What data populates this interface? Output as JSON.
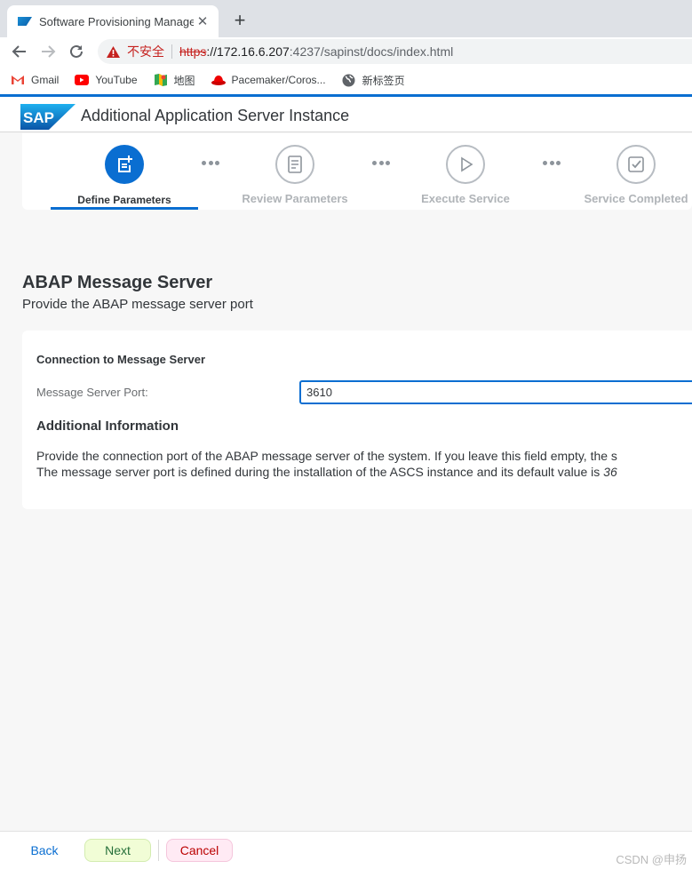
{
  "browser": {
    "tab": {
      "title": "Software Provisioning Manage",
      "close_glyph": "✕"
    },
    "new_tab_glyph": "+",
    "address_bar": {
      "security_label": "不安全",
      "scheme": "https",
      "host": "://172.16.6.207",
      "path": ":4237/sapinst/docs/index.html"
    },
    "bookmarks": [
      {
        "label": "Gmail",
        "icon": "gmail-icon"
      },
      {
        "label": "YouTube",
        "icon": "youtube-icon"
      },
      {
        "label": "地图",
        "icon": "maps-icon"
      },
      {
        "label": "Pacemaker/Coros...",
        "icon": "redhat-icon"
      },
      {
        "label": "新标签页",
        "icon": "globe-icon"
      }
    ]
  },
  "app": {
    "logo_text": "SAP",
    "title": "Additional Application Server Instance",
    "brand_color": "#0a6ed1"
  },
  "wizard": {
    "steps": [
      {
        "label": "Define Parameters",
        "state": "active"
      },
      {
        "label": "Review Parameters",
        "state": "inactive"
      },
      {
        "label": "Execute Service",
        "state": "inactive"
      },
      {
        "label": "Service Completed",
        "state": "inactive"
      }
    ]
  },
  "content": {
    "title": "ABAP Message Server",
    "subtitle": "Provide the ABAP message server port",
    "group_title": "Connection to Message Server",
    "field_label": "Message Server Port:",
    "field_value": "3610",
    "additional_info_title": "Additional Information",
    "additional_info_line1": "Provide the connection port of the ABAP message server of the system. If you leave this field empty, the s",
    "additional_info_line2_prefix": "The message server port is defined during the installation of the ASCS instance and its default value is ",
    "additional_info_line2_em": "36"
  },
  "footer": {
    "back_label": "Back",
    "next_label": "Next",
    "cancel_label": "Cancel",
    "watermark": "CSDN @申扬"
  }
}
